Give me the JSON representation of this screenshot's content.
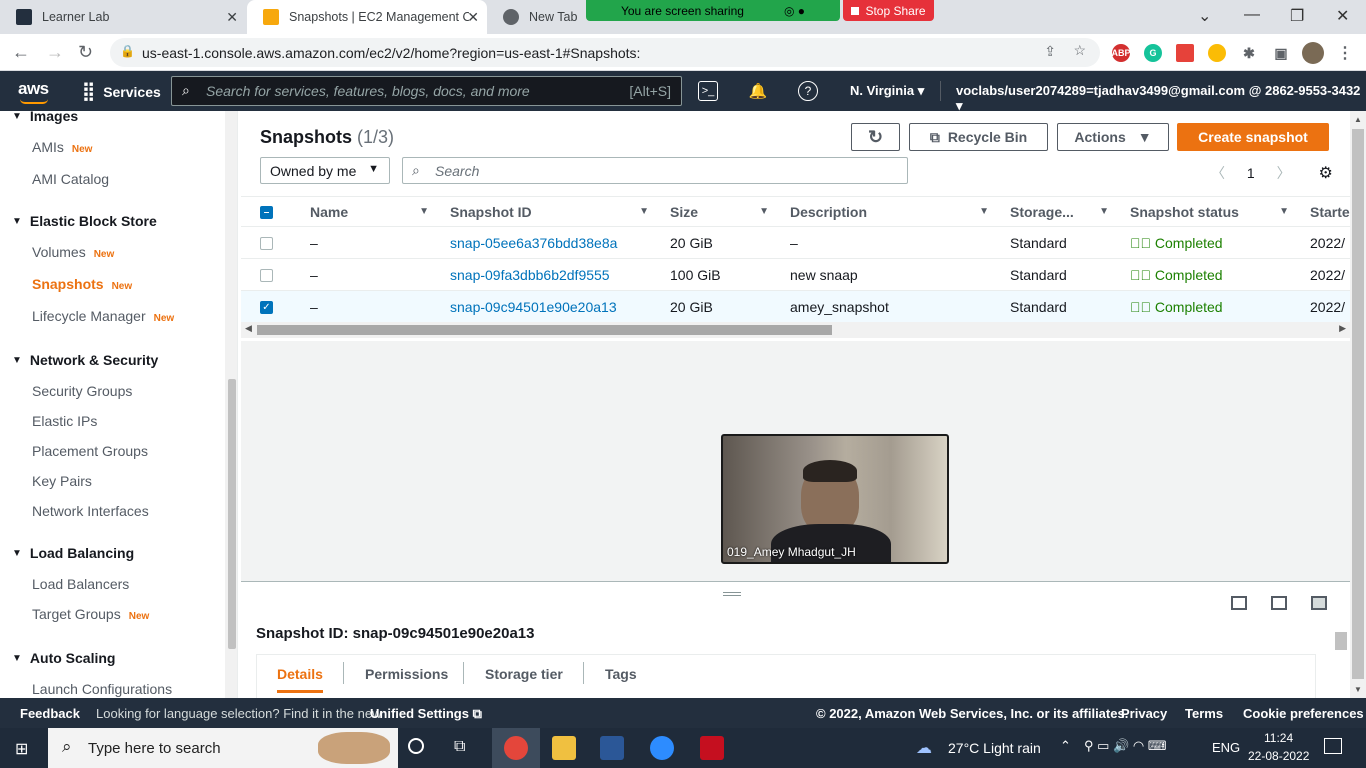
{
  "browser": {
    "tabs": [
      {
        "title": "Learner Lab"
      },
      {
        "title": "Snapshots | EC2 Management Co"
      },
      {
        "title": "New Tab"
      }
    ],
    "share_banner": "You are screen sharing",
    "stop_share": "Stop Share",
    "url": "us-east-1.console.aws.amazon.com/ec2/v2/home?region=us-east-1#Snapshots:"
  },
  "header": {
    "logo": "aws",
    "services": "Services",
    "search_placeholder": "Search for services, features, blogs, docs, and more",
    "search_shortcut": "[Alt+S]",
    "region": "N. Virginia",
    "account": "voclabs/user2074289=tjadhav3499@gmail.com @ 2862-9553-3432"
  },
  "sidebar": {
    "new_badge": "New",
    "sections": [
      {
        "title": "Images",
        "items": [
          {
            "label": "AMIs",
            "new": true
          },
          {
            "label": "AMI Catalog",
            "new": false
          }
        ]
      },
      {
        "title": "Elastic Block Store",
        "items": [
          {
            "label": "Volumes",
            "new": true
          },
          {
            "label": "Snapshots",
            "new": true
          },
          {
            "label": "Lifecycle Manager",
            "new": true
          }
        ]
      },
      {
        "title": "Network & Security",
        "items": [
          {
            "label": "Security Groups"
          },
          {
            "label": "Elastic IPs"
          },
          {
            "label": "Placement Groups"
          },
          {
            "label": "Key Pairs"
          },
          {
            "label": "Network Interfaces"
          }
        ]
      },
      {
        "title": "Load Balancing",
        "items": [
          {
            "label": "Load Balancers"
          },
          {
            "label": "Target Groups",
            "new": true
          }
        ]
      },
      {
        "title": "Auto Scaling",
        "items": [
          {
            "label": "Launch Configurations"
          }
        ]
      }
    ]
  },
  "main": {
    "title": "Snapshots",
    "count": "(1/3)",
    "buttons": {
      "recycle": "Recycle Bin",
      "actions": "Actions",
      "create": "Create snapshot"
    },
    "filter": "Owned by me",
    "search_placeholder": "Search",
    "page": "1",
    "columns": [
      "Name",
      "Snapshot ID",
      "Size",
      "Description",
      "Storage...",
      "Snapshot status",
      "Starte"
    ],
    "rows": [
      {
        "name": "–",
        "id": "snap-05ee6a376bdd38e8a",
        "size": "20 GiB",
        "desc": "–",
        "storage": "Standard",
        "status": "Completed",
        "started": "2022/",
        "selected": false
      },
      {
        "name": "–",
        "id": "snap-09fa3dbb6b2df9555",
        "size": "100 GiB",
        "desc": "new snaap",
        "storage": "Standard",
        "status": "Completed",
        "started": "2022/",
        "selected": false
      },
      {
        "name": "–",
        "id": "snap-09c94501e90e20a13",
        "size": "20 GiB",
        "desc": "amey_snapshot",
        "storage": "Standard",
        "status": "Completed",
        "started": "2022/",
        "selected": true
      }
    ]
  },
  "split_panel": {
    "title": "Snapshot ID: snap-09c94501e90e20a13",
    "tabs": [
      "Details",
      "Permissions",
      "Storage tier",
      "Tags"
    ]
  },
  "video": {
    "name": "019_Amey Mhadgut_JH"
  },
  "footer": {
    "feedback": "Feedback",
    "lang_text": "Looking for language selection? Find it in the new",
    "lang_link": "Unified Settings",
    "copyright": "© 2022, Amazon Web Services, Inc. or its affiliates.",
    "privacy": "Privacy",
    "terms": "Terms",
    "cookies": "Cookie preferences"
  },
  "taskbar": {
    "search_placeholder": "Type here to search",
    "weather": "27°C  Light rain",
    "lang": "ENG",
    "time": "11:24",
    "date": "22-08-2022"
  },
  "colors": {
    "accent": "#ec7211",
    "link": "#0073bb",
    "success": "#1d8102",
    "header": "#232f3e"
  }
}
